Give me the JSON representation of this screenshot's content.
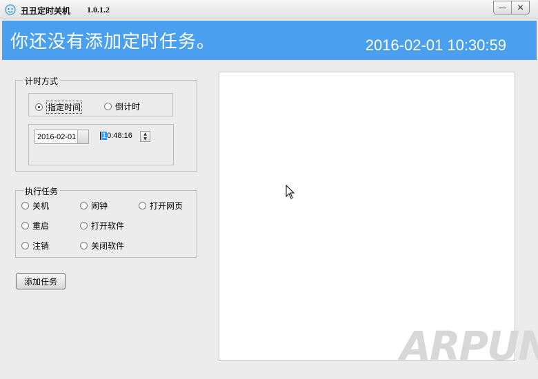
{
  "window": {
    "title": "丑丑定时关机",
    "version": "1.0.1.2",
    "minimize_glyph": "—",
    "close_glyph": "✕"
  },
  "banner": {
    "message": "你还没有添加定时任务。",
    "clock": "2016-02-01 10:30:59",
    "color": "#4aa0ee"
  },
  "timing_group": {
    "title": "计时方式",
    "options": [
      {
        "label": "指定时间",
        "selected": true
      },
      {
        "label": "倒计时",
        "selected": false
      }
    ],
    "date_value": "2016-02-01",
    "time_hour_selected": "1",
    "time_rest": "0:48:16"
  },
  "task_group": {
    "title": "执行任务",
    "options": [
      {
        "label": "关机"
      },
      {
        "label": "闹钟"
      },
      {
        "label": "打开网页"
      },
      {
        "label": "重启"
      },
      {
        "label": "打开软件"
      },
      {
        "label": "注销"
      },
      {
        "label": "关闭软件"
      }
    ]
  },
  "add_button": {
    "label": "添加任务"
  },
  "watermark": "ARPUN"
}
